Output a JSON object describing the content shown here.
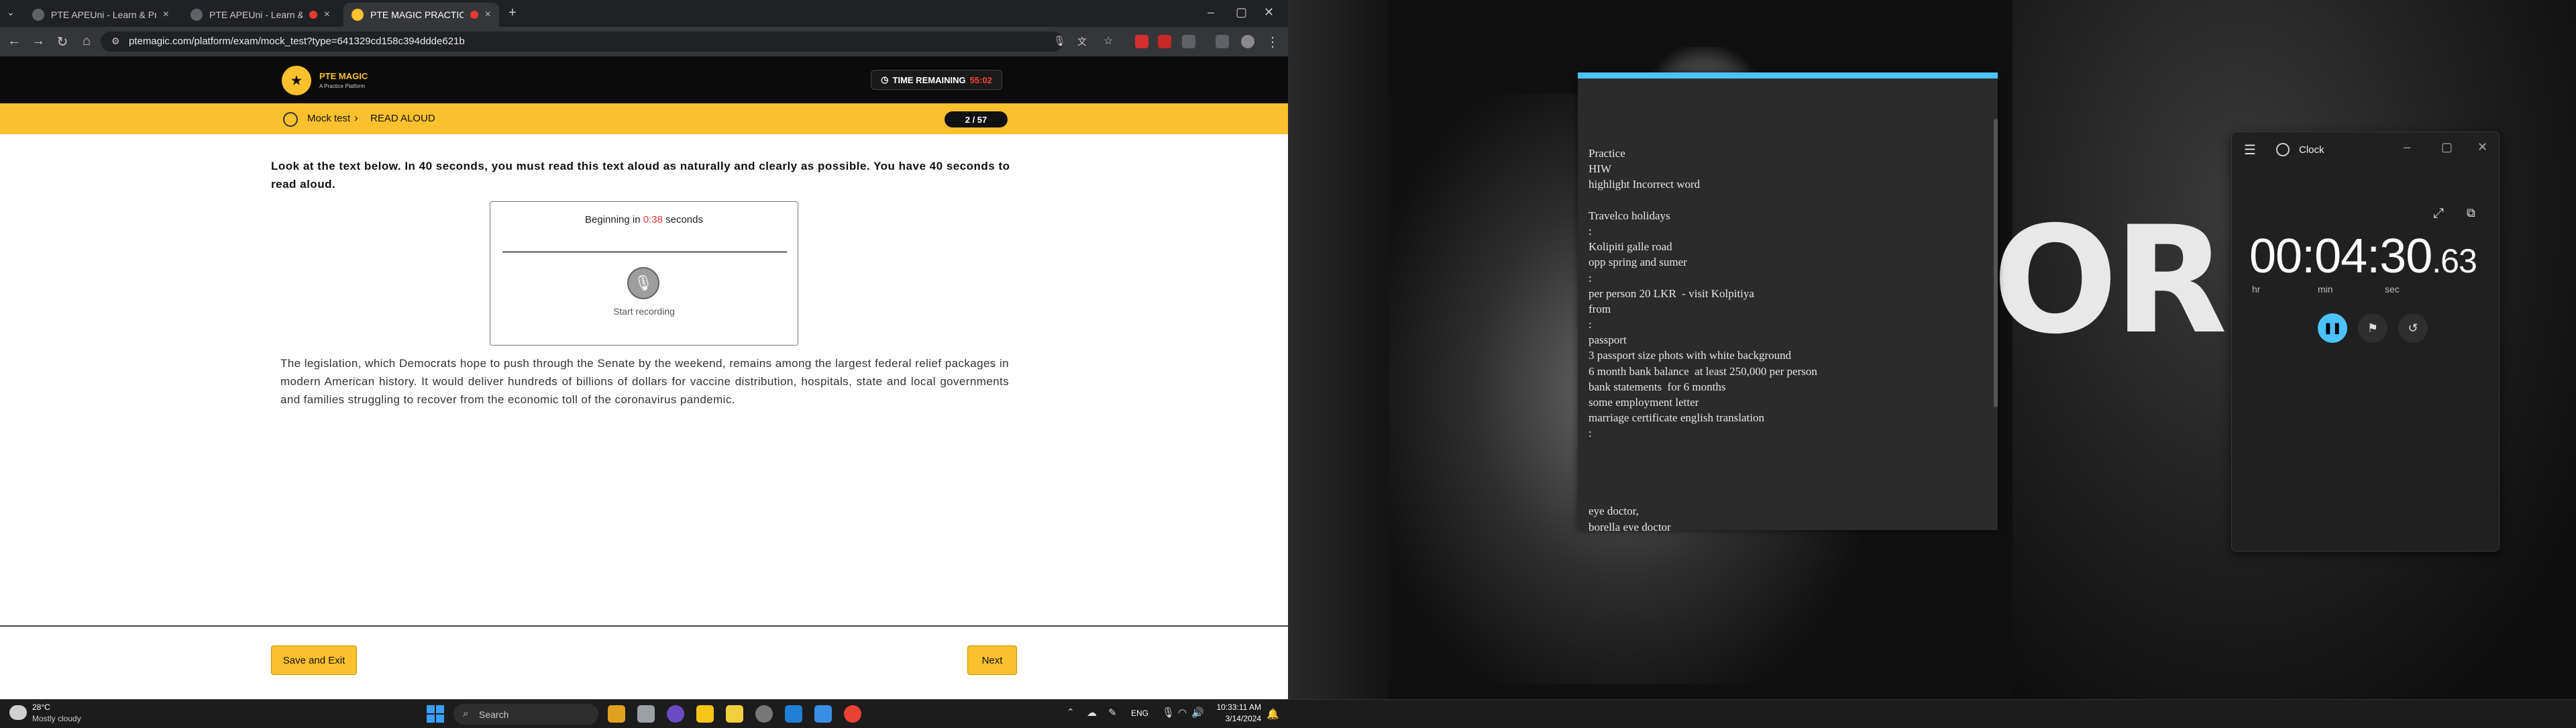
{
  "browser": {
    "tabs": [
      {
        "label": "PTE APEUni - Learn & Practice..."
      },
      {
        "label": "PTE APEUni - Learn & Practice..."
      },
      {
        "label": "PTE MAGIC PRACTICE"
      }
    ],
    "url": "ptemagic.com/platform/exam/mock_test?type=641329cd158c394ddde621b"
  },
  "page": {
    "brand": "PTE MAGIC",
    "brand_sub": "A Practice Platform",
    "timer_label": "TIME REMAINING",
    "timer_value": "55:02",
    "breadcrumb": {
      "parent": "Mock test",
      "current": "READ ALOUD"
    },
    "counter": "2 / 57",
    "instruction": "Look at the text below. In 40 seconds, you must read this text aloud as naturally and clearly as possible. You have 40 seconds to read aloud.",
    "recorder": {
      "begin_prefix": "Beginning in",
      "countdown": "0:38",
      "begin_suffix": "seconds",
      "label": "Start recording"
    },
    "passage": "The legislation, which Democrats hope to push through the Senate by the weekend, remains among the largest federal relief packages in modern American history. It would deliver hundreds of billions of dollars for vaccine distribution, hospitals, state and local governments and families struggling to recover from the economic toll of the coronavirus pandemic.",
    "save_exit_label": "Save and Exit",
    "next_label": "Next"
  },
  "notes": {
    "lines": [
      "Practice",
      "HIW",
      "highlight Incorrect word",
      "",
      "Travelco holidays",
      ":",
      "Kolipiti galle road",
      "opp spring and sumer",
      ":",
      "per person 20 LKR  - visit Kolpitiya",
      "from",
      ":",
      "passport",
      "3 passport size phots with white background",
      "6 month bank balance  at least 250,000 per person",
      "bank statements  for 6 months",
      "some employment letter",
      "marriage certificate english translation",
      ":",
      "",
      "",
      "",
      "",
      "eye doctor,",
      "borella eye doctor"
    ]
  },
  "clock": {
    "title": "Clock",
    "time_main": "00:04:30",
    "time_frac": ".63",
    "units": {
      "hr": "hr",
      "min": "min",
      "sec": "sec"
    }
  },
  "wallpaper": {
    "word": "ORI"
  },
  "taskbar": {
    "weather_temp": "28°C",
    "weather_desc": "Mostly cloudy",
    "search_label": "Search",
    "lang": "ENG",
    "time": "10:33:11 AM",
    "date": "3/14/2024"
  },
  "colors": {
    "accent": "#fbc02d",
    "timer_red": "#f44336",
    "clock_accent": "#4cc2ff"
  }
}
